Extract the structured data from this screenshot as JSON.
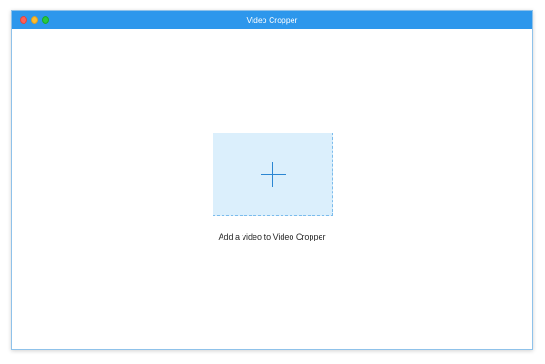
{
  "window": {
    "title": "Video Cropper"
  },
  "main": {
    "drop_zone_icon": "plus-icon",
    "prompt": "Add a video to Video Cropper"
  },
  "colors": {
    "titlebar": "#2d97ec",
    "drop_zone_fill": "#dbeffc",
    "drop_zone_border": "#7cbcec",
    "plus": "#2b86d2"
  }
}
